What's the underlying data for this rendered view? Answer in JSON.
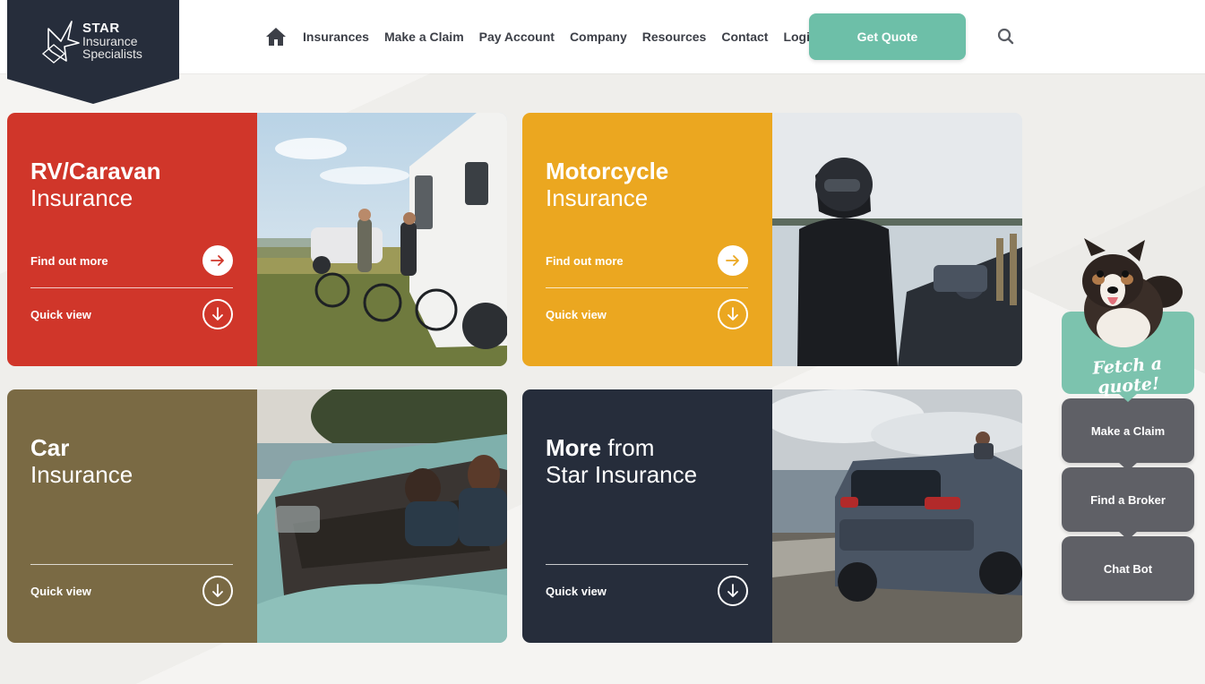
{
  "logo": {
    "line1": "STAR",
    "line2": "Insurance",
    "line3": "Specialists"
  },
  "nav": {
    "items": [
      "Insurances",
      "Make a Claim",
      "Pay Account",
      "Company",
      "Resources",
      "Contact",
      "Login"
    ],
    "quote_button": "Get Quote"
  },
  "cards": [
    {
      "title_bold": "RV/Caravan",
      "title_light": "Insurance",
      "find_out_more": "Find out more",
      "quick_view": "Quick view",
      "color": "#d0362a"
    },
    {
      "title_bold": "Motorcycle",
      "title_light": "Insurance",
      "find_out_more": "Find out more",
      "quick_view": "Quick view",
      "color": "#eba720"
    },
    {
      "title_bold": "Car",
      "title_light": "Insurance",
      "quick_view": "Quick view",
      "color": "#7a6a44"
    },
    {
      "title_bold": "More",
      "title_bold_rest": " from",
      "title_light": "Star Insurance",
      "quick_view": "Quick view",
      "color": "#262d3b"
    }
  ],
  "sidebar": {
    "fetch_quote": "Fetch a quote!",
    "make_claim": "Make a Claim",
    "find_broker": "Find a Broker",
    "chat_bot": "Chat Bot"
  },
  "colors": {
    "accent": "#6dbfa8",
    "navy": "#262d3b",
    "grey_button": "#5f6066"
  }
}
